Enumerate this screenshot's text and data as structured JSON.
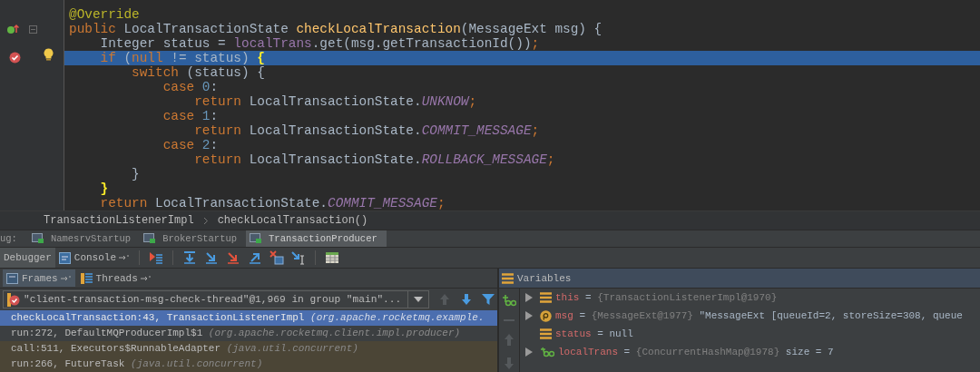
{
  "editor": {
    "lines": [
      {
        "highlighted": false,
        "tokens": [
          {
            "text": "@Override",
            "kind": "annotation"
          }
        ]
      },
      {
        "highlighted": false,
        "kind": "override",
        "tokens": [
          {
            "text": "public ",
            "kind": "keyword"
          },
          {
            "text": "LocalTransactionState ",
            "kind": "plain"
          },
          {
            "text": "checkLocalTransaction",
            "kind": "method"
          },
          {
            "text": "(MessageExt msg) {",
            "kind": "plain"
          }
        ]
      },
      {
        "highlighted": false,
        "tokens": [
          {
            "text": "    Integer status = ",
            "kind": "plain"
          },
          {
            "text": "localTrans",
            "kind": "field"
          },
          {
            "text": ".get(msg.getTransactionId())",
            "kind": "plain"
          },
          {
            "text": ";",
            "kind": "keyword"
          }
        ]
      },
      {
        "highlighted": true,
        "kind": "breakpoint",
        "tokens": [
          {
            "text": "    if ",
            "kind": "keyword"
          },
          {
            "text": "(",
            "kind": "plain"
          },
          {
            "text": "null ",
            "kind": "keyword"
          },
          {
            "text": "!= status) ",
            "kind": "plain"
          },
          {
            "text": "{",
            "kind": "brace"
          }
        ]
      },
      {
        "highlighted": false,
        "tokens": [
          {
            "text": "        switch ",
            "kind": "keyword"
          },
          {
            "text": "(status) {",
            "kind": "plain"
          }
        ]
      },
      {
        "highlighted": false,
        "tokens": [
          {
            "text": "            case ",
            "kind": "keyword"
          },
          {
            "text": "0",
            "kind": "number"
          },
          {
            "text": ":",
            "kind": "plain"
          }
        ]
      },
      {
        "highlighted": false,
        "tokens": [
          {
            "text": "                return ",
            "kind": "keyword"
          },
          {
            "text": "LocalTransactionState.",
            "kind": "plain"
          },
          {
            "text": "UNKNOW",
            "kind": "constant"
          },
          {
            "text": ";",
            "kind": "keyword"
          }
        ]
      },
      {
        "highlighted": false,
        "tokens": [
          {
            "text": "            case ",
            "kind": "keyword"
          },
          {
            "text": "1",
            "kind": "number"
          },
          {
            "text": ":",
            "kind": "plain"
          }
        ]
      },
      {
        "highlighted": false,
        "tokens": [
          {
            "text": "                return ",
            "kind": "keyword"
          },
          {
            "text": "LocalTransactionState.",
            "kind": "plain"
          },
          {
            "text": "COMMIT_MESSAGE",
            "kind": "constant"
          },
          {
            "text": ";",
            "kind": "keyword"
          }
        ]
      },
      {
        "highlighted": false,
        "tokens": [
          {
            "text": "            case ",
            "kind": "keyword"
          },
          {
            "text": "2",
            "kind": "number"
          },
          {
            "text": ":",
            "kind": "plain"
          }
        ]
      },
      {
        "highlighted": false,
        "tokens": [
          {
            "text": "                return ",
            "kind": "keyword"
          },
          {
            "text": "LocalTransactionState.",
            "kind": "plain"
          },
          {
            "text": "ROLLBACK_MESSAGE",
            "kind": "constant"
          },
          {
            "text": ";",
            "kind": "keyword"
          }
        ]
      },
      {
        "highlighted": false,
        "tokens": [
          {
            "text": "        }",
            "kind": "plain"
          }
        ]
      },
      {
        "highlighted": false,
        "tokens": [
          {
            "text": "    }",
            "kind": "brace"
          }
        ]
      },
      {
        "highlighted": false,
        "tokens": [
          {
            "text": "    return ",
            "kind": "keyword"
          },
          {
            "text": "LocalTransactionState.",
            "kind": "plain"
          },
          {
            "text": "COMMIT_MESSAGE",
            "kind": "constant"
          },
          {
            "text": ";",
            "kind": "keyword"
          }
        ]
      }
    ]
  },
  "breadcrumb": [
    "TransactionListenerImpl",
    "checkLocalTransaction()"
  ],
  "debug_bar": {
    "label": "ug:",
    "sessions": [
      {
        "label": "NamesrvStartup",
        "selected": false
      },
      {
        "label": "BrokerStartup",
        "selected": false
      },
      {
        "label": "TransactionProducer",
        "selected": true
      }
    ]
  },
  "debug_tabs": [
    {
      "label": "Debugger",
      "selected": true,
      "pinned": false
    },
    {
      "label": "Console",
      "selected": false,
      "pinned": true
    }
  ],
  "frames_tabs": [
    {
      "label": "Frames",
      "selected": true,
      "pinned": true
    },
    {
      "label": "Threads",
      "selected": false,
      "pinned": true
    }
  ],
  "thread": {
    "value": "\"client-transaction-msg-check-thread\"@1,969 in group \"main\"..."
  },
  "frames": [
    {
      "location": "checkLocalTransaction:43, TransactionListenerImpl",
      "package": "(org.apache.rocketmq.example.",
      "selected": true,
      "kind": "app"
    },
    {
      "location": "run:272, DefaultMQProducerImpl$1",
      "package": "(org.apache.rocketmq.client.impl.producer)",
      "selected": false,
      "kind": "app"
    },
    {
      "location": "call:511, Executors$RunnableAdapter",
      "package": "(java.util.concurrent)",
      "selected": false,
      "kind": "library"
    },
    {
      "location": "run:266, FutureTask",
      "package": "(java.util.concurrent)",
      "selected": false,
      "kind": "library"
    }
  ],
  "variables": {
    "title": "Variables",
    "items": [
      {
        "name": "this",
        "operator": "=",
        "kind": "field",
        "expandable": true,
        "value": "{TransactionListenerImpl@1970}",
        "reference": true
      },
      {
        "name": "msg",
        "operator": "=",
        "kind": "parameter",
        "expandable": true,
        "value": "{MessageExt@1977}",
        "reference": true,
        "detail": "\"MessageExt [queueId=2, storeSize=308, queue"
      },
      {
        "name": "status",
        "operator": "=",
        "kind": "field",
        "expandable": false,
        "value": "null",
        "reference": false
      },
      {
        "name": "localTrans",
        "operator": "=",
        "kind": "watch",
        "expandable": true,
        "value": "{ConcurrentHashMap@1978}",
        "reference": true,
        "detail": "size = 7"
      }
    ]
  }
}
